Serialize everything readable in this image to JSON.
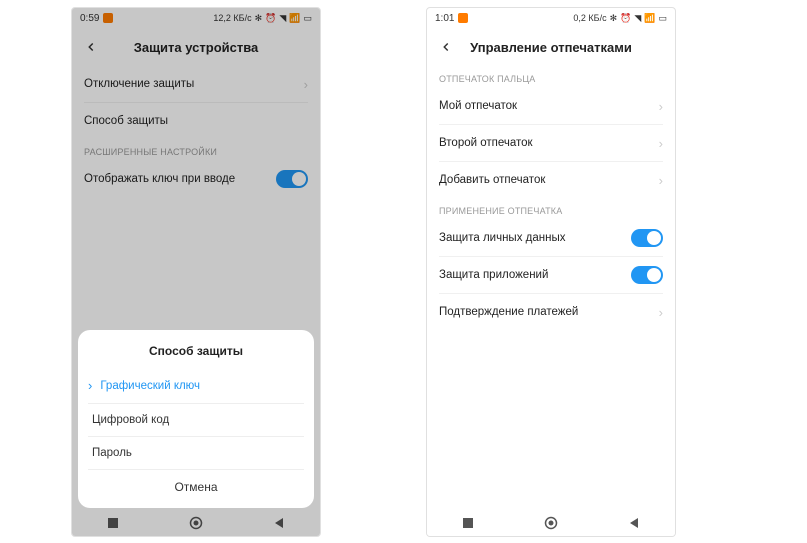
{
  "left": {
    "status": {
      "time": "0:59",
      "net": "12,2 КБ/с"
    },
    "header": {
      "title": "Защита устройства"
    },
    "rows": {
      "disable": "Отключение защиты",
      "method": "Способ защиты"
    },
    "section_advanced": "РАСШИРЕННЫЕ НАСТРОЙКИ",
    "show_key": "Отображать ключ при вводе",
    "sheet": {
      "title": "Способ защиты",
      "pattern": "Графический ключ",
      "pin": "Цифровой код",
      "password": "Пароль",
      "cancel": "Отмена"
    }
  },
  "right": {
    "status": {
      "time": "1:01",
      "net": "0,2 КБ/с"
    },
    "header": {
      "title": "Управление отпечатками"
    },
    "section_finger": "ОТПЕЧАТОК ПАЛЬЦА",
    "fp1": "Мой отпечаток",
    "fp2": "Второй отпечаток",
    "fp_add": "Добавить отпечаток",
    "section_usage": "ПРИМЕНЕНИЕ ОТПЕЧАТКА",
    "privacy": "Защита личных данных",
    "apps": "Защита приложений",
    "payments": "Подтверждение платежей"
  }
}
